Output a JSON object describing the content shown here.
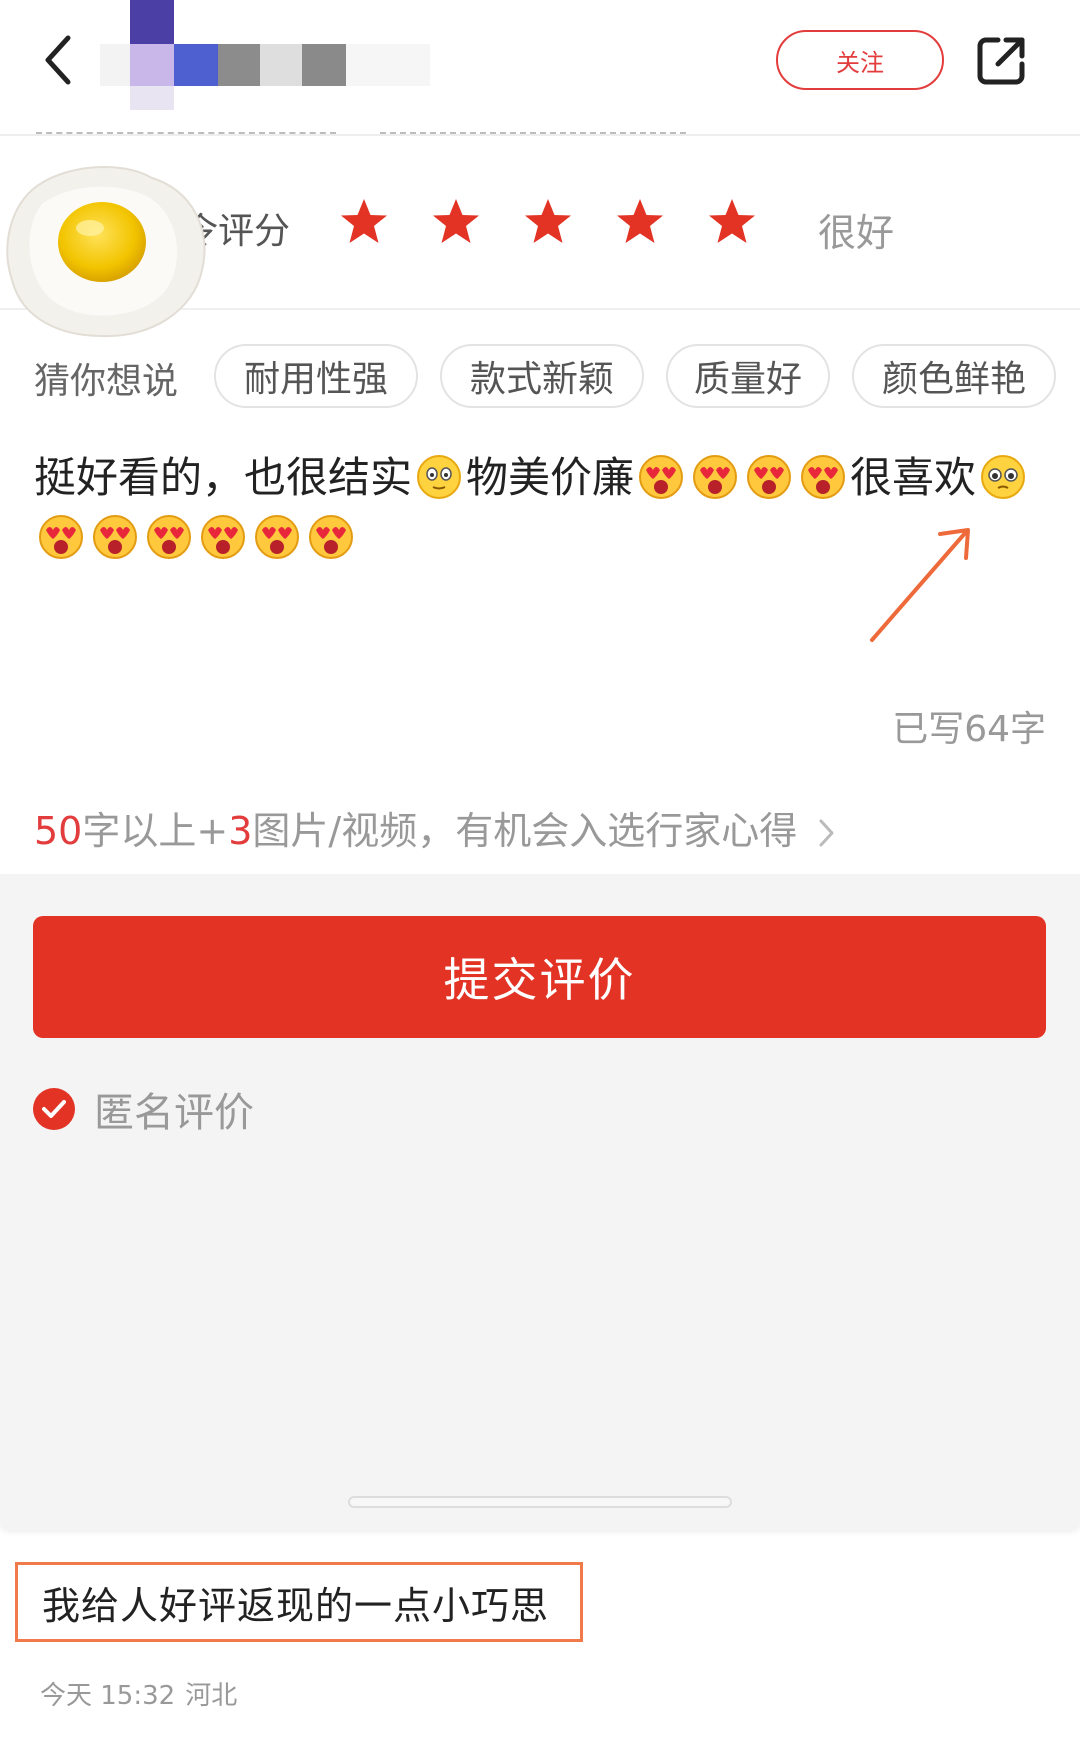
{
  "header": {
    "follow_label": "关注",
    "back_icon": "back-arrow-icon",
    "share_icon": "share-icon"
  },
  "rating": {
    "label": "令评分",
    "stars": 5,
    "max_stars": 5,
    "text": "很好",
    "star_color": "#e23325"
  },
  "tags": {
    "title": "猜你想说",
    "items": [
      "耐用性强",
      "款式新颖",
      "质量好",
      "颜色鲜艳"
    ]
  },
  "comment": {
    "part1": "挺好看的，也很结实",
    "part2": "物美价廉",
    "part3": "很喜欢",
    "count_label": "已写64字"
  },
  "hint": {
    "num1": "50",
    "text1": "字以上+",
    "num2": "3",
    "text2": "图片/视频，有机会入选行家心得"
  },
  "actions": {
    "submit_label": "提交评价",
    "anonymous_label": "匿名评价",
    "anonymous_checked": true
  },
  "caption": {
    "title": "我给人好评返现的一点小巧思",
    "time": "今天 15:32",
    "location": "河北"
  },
  "colors": {
    "accent": "#e23325",
    "highlight_border": "#f07a4a"
  }
}
